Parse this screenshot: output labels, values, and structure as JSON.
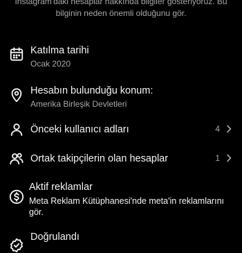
{
  "intro": {
    "line1": "Instagram'daki hesaplar hakkında bilgiler gösteriyoruz. Bu",
    "line2": "bilginin neden önemli olduğunu gör."
  },
  "items": [
    {
      "title": "Katılma tarihi",
      "subtitle": "Ocak 2020",
      "icon": "calendar-icon"
    },
    {
      "title": "Hesabın bulunduğu konum:",
      "subtitle": "Amerika Birleşik Devletleri",
      "icon": "location-pin-icon"
    },
    {
      "title": "Önceki kullanıcı adları",
      "count": "4",
      "icon": "person-icon"
    },
    {
      "title": "Ortak takipçilerin olan hesaplar",
      "count": "1",
      "icon": "people-icon"
    },
    {
      "title": "Aktif reklamlar",
      "description": "Meta Reklam Kütüphanesi'nde meta'in reklamlarını gör.",
      "icon": "dollar-circle-icon"
    },
    {
      "title": "Doğrulandı",
      "icon": "verified-badge-icon"
    }
  ],
  "colors": {
    "background": "#000000",
    "text": "#f5f5f5",
    "muted": "#a8a8a8"
  }
}
